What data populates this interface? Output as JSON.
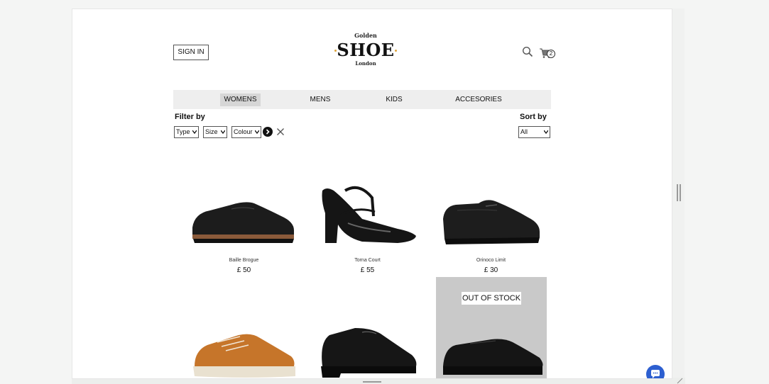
{
  "header": {
    "signin_label": "SIGN IN",
    "logo_top": "Golden",
    "logo_main": "SHOE",
    "logo_bottom": "London",
    "cart_count": "2"
  },
  "nav": {
    "items": [
      {
        "label": "WOMENS",
        "active": true
      },
      {
        "label": "MENS",
        "active": false
      },
      {
        "label": "KIDS",
        "active": false
      },
      {
        "label": "ACCESORIES",
        "active": false
      }
    ]
  },
  "filters": {
    "title": "Filter by",
    "type_value": "Type",
    "size_value": "Size",
    "colour_value": "Colour"
  },
  "sort": {
    "title": "Sort by",
    "value": "All"
  },
  "products": [
    {
      "name": "Baille Brogue",
      "price": "£ 50"
    },
    {
      "name": "Torna Court",
      "price": "£ 55"
    },
    {
      "name": "Orinoco Limit",
      "price": "£ 30"
    },
    {
      "name": "",
      "price": ""
    },
    {
      "name": "",
      "price": ""
    },
    {
      "name": "",
      "price": ""
    }
  ],
  "out_of_stock_label": "OUT OF STOCK",
  "colors": {
    "nav_bg": "#eeeeee",
    "nav_active": "#d6d6d6",
    "logo_accent": "#e0a43a",
    "chat": "#2d5fd0",
    "oos_bg": "#c9c9c9"
  }
}
